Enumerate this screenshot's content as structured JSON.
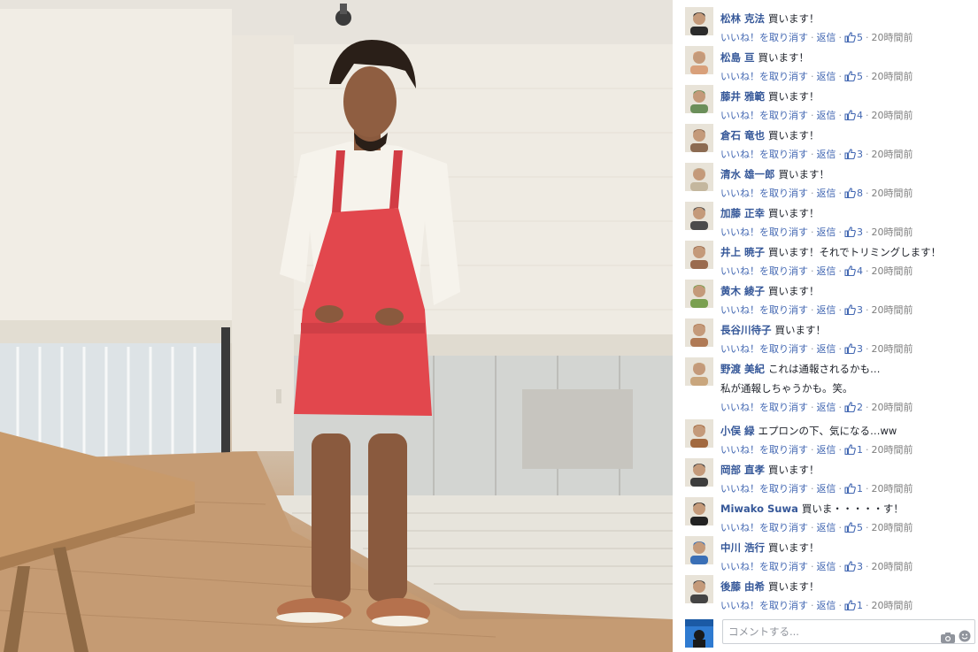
{
  "photo": {
    "alt_icon": "photo-icon"
  },
  "comments": [
    {
      "author": "松林 克法",
      "text": "買います！",
      "extra": "",
      "likes": "5"
    },
    {
      "author": "松島 亘",
      "text": "買います！",
      "extra": "",
      "likes": "5"
    },
    {
      "author": "藤井 雅範",
      "text": "買います！",
      "extra": "",
      "likes": "4"
    },
    {
      "author": "倉石 竜也",
      "text": "買います！",
      "extra": "",
      "likes": "3"
    },
    {
      "author": "清水 雄一郎",
      "text": "買います！",
      "extra": "",
      "likes": "8"
    },
    {
      "author": "加藤 正幸",
      "text": "買います！",
      "extra": "",
      "likes": "3"
    },
    {
      "author": "井上 暁子",
      "text": "買います！それでトリミングします！",
      "extra": "",
      "likes": "4"
    },
    {
      "author": "黄木 綾子",
      "text": "買います！",
      "extra": "",
      "likes": "3"
    },
    {
      "author": "長谷川待子",
      "text": "買います！",
      "extra": "",
      "likes": "3"
    },
    {
      "author": "野渡 美紀",
      "text": "これは通報されるかも…",
      "extra": "私が通報しちゃうかも。笑。",
      "likes": "2"
    },
    {
      "author": "小俣 緑",
      "text": "エプロンの下、気になる…ww",
      "extra": "",
      "likes": "1"
    },
    {
      "author": "岡部 直孝",
      "text": "買います！",
      "extra": "",
      "likes": "1"
    },
    {
      "author": "Miwako Suwa",
      "text": "買いま・・・・・す！",
      "extra": "",
      "likes": "5"
    },
    {
      "author": "中川 浩行",
      "text": "買います！",
      "extra": "",
      "likes": "3"
    },
    {
      "author": "後藤 由希",
      "text": "買います！",
      "extra": "",
      "likes": "1"
    }
  ],
  "meta": {
    "unlike": "いいね！を取り消す",
    "reply": "返信",
    "sep": "·",
    "time": "20時間前"
  },
  "composer": {
    "placeholder": "コメントする..."
  },
  "colors": {
    "author": "#365899",
    "link": "#4267b2",
    "meta": "#90949c",
    "apron": "#e2474d"
  }
}
